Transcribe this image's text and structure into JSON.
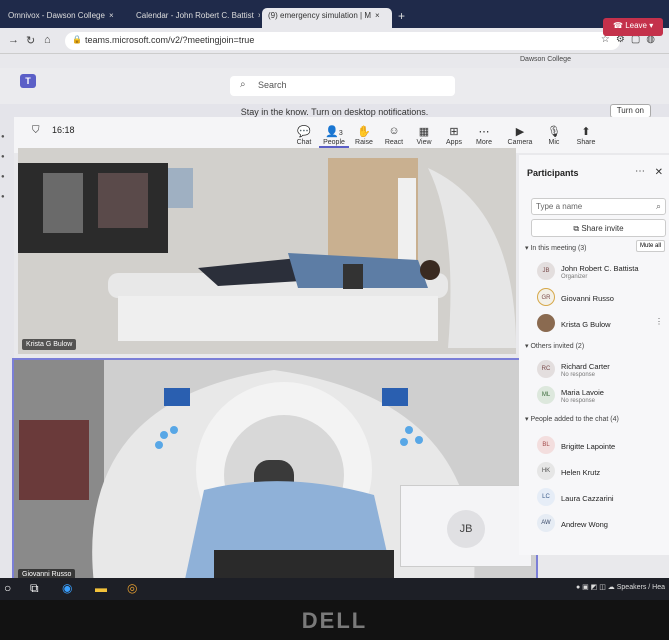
{
  "browser": {
    "tabs": [
      {
        "label": "Omnivox - Dawson College",
        "active": false
      },
      {
        "label": "Calendar - John Robert C. Battist",
        "active": false
      },
      {
        "label": "(9) emergency simulation | M",
        "active": true
      }
    ],
    "new_tab": "+",
    "url": "teams.microsoft.com/v2/?meetingjoin=true",
    "bookmarks_label": "Dawson College"
  },
  "teams": {
    "search_placeholder": "Search",
    "notification": "Stay in the know. Turn on desktop notifications.",
    "turn_on": "Turn on"
  },
  "meeting": {
    "timer": "16:18",
    "controls": [
      {
        "label": "Chat",
        "icon": "chat-icon",
        "glyph": "💬"
      },
      {
        "label": "People",
        "icon": "people-icon",
        "glyph": "👤"
      },
      {
        "label": "Raise",
        "icon": "hand-icon",
        "glyph": "✋"
      },
      {
        "label": "React",
        "icon": "smile-icon",
        "glyph": "☺"
      },
      {
        "label": "View",
        "icon": "grid-icon",
        "glyph": "▦"
      },
      {
        "label": "Apps",
        "icon": "plus-icon",
        "glyph": "⊞"
      },
      {
        "label": "More",
        "icon": "more-icon",
        "glyph": "⋯"
      },
      {
        "label": "Camera",
        "icon": "camera-icon",
        "glyph": "▶"
      },
      {
        "label": "Mic",
        "icon": "mic-icon",
        "glyph": "🎙"
      },
      {
        "label": "Share",
        "icon": "share-icon",
        "glyph": "⬆"
      }
    ],
    "people_count": "3",
    "leave": "Leave",
    "tiles": [
      {
        "name": "Krista G Bulow"
      },
      {
        "name": "Giovanni Russo"
      }
    ],
    "self_initials": "JB"
  },
  "participants": {
    "title": "Participants",
    "search_placeholder": "Type a name",
    "share_invite": "Share invite",
    "in_meeting_header": "In this meeting (3)",
    "mute_all": "Mute all",
    "in_meeting": [
      {
        "initials": "JB",
        "name": "John Robert C. Battista",
        "role": "Organizer"
      },
      {
        "initials": "GR",
        "name": "Giovanni Russo",
        "role": ""
      },
      {
        "initials": "KG",
        "name": "Krista G Bulow",
        "role": ""
      }
    ],
    "others_header": "Others invited (2)",
    "others": [
      {
        "initials": "RC",
        "name": "Richard Carter",
        "role": "No response"
      },
      {
        "initials": "ML",
        "name": "Maria Lavoie",
        "role": "No response"
      }
    ],
    "chat_header": "People added to the chat (4)",
    "chat": [
      {
        "initials": "BL",
        "name": "Brigitte Lapointe"
      },
      {
        "initials": "HK",
        "name": "Helen Krutz"
      },
      {
        "initials": "LC",
        "name": "Laura Cazzarini"
      },
      {
        "initials": "AW",
        "name": "Andrew Wong"
      }
    ]
  },
  "taskbar": {
    "tray_text": "Speakers / Hea"
  },
  "bezel": {
    "brand": "DELL"
  },
  "colors": {
    "accent": "#5b5fc7",
    "leave": "#c4314b"
  }
}
